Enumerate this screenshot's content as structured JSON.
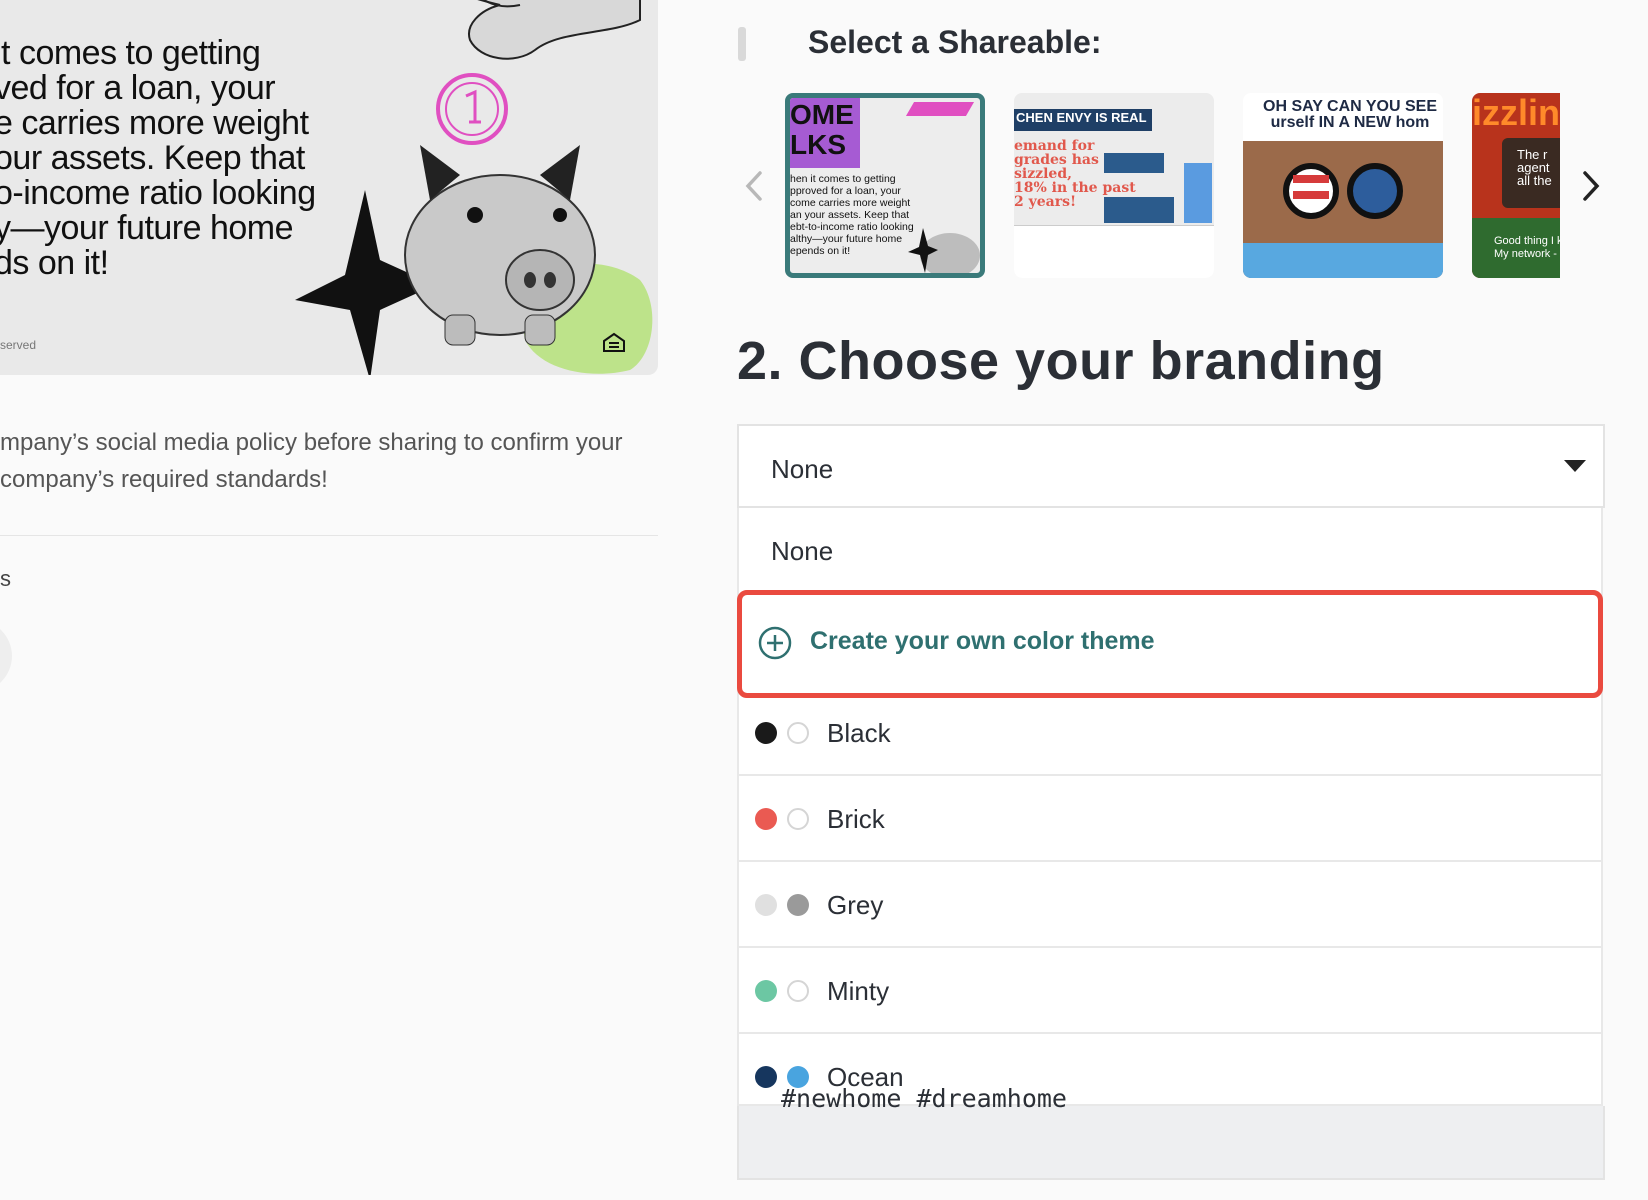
{
  "preview": {
    "text": "it comes to getting\nved for a loan, your\ne carries more weight\nour assets. Keep that\no-income ratio looking\ny—your future home\nds on it!",
    "footer": "served"
  },
  "policy_text": "mpany’s social media policy before sharing to confirm your company’s required standards!",
  "left_fragment": "s",
  "shareable": {
    "title": "Select a Shareable:",
    "thumbs": [
      {
        "heading": "OME\nLKS",
        "body": "hen it comes to getting\npproved for a loan, your\ncome carries more weight\nan your assets. Keep that\nebt-to-income ratio looking\nalthy—your future home\nepends on it!",
        "selected": true
      },
      {
        "heading": "CHEN ENVY IS REAL",
        "body": "emand for\ngrades has\nsizzled,\n18% in the past\n2 years!",
        "selected": false
      },
      {
        "heading": "OH SAY CAN YOU SEE\nurself IN A NEW hom",
        "body": "",
        "selected": false
      },
      {
        "heading": "izzlin",
        "body": "The r\nagent\nall the",
        "footer": "Good thing I kn\nMy network -",
        "selected": false
      }
    ]
  },
  "branding": {
    "title": "2. Choose your branding",
    "selected": "None",
    "options": {
      "none": "None",
      "create": "Create your own color theme",
      "themes": [
        {
          "label": "Black",
          "color1": "#1a1a1a",
          "color2": "#ffffff"
        },
        {
          "label": "Brick",
          "color1": "#ea5a52",
          "color2": "#ffffff"
        },
        {
          "label": "Grey",
          "color1": "#e0e0e0",
          "color2": "#9a9a9a"
        },
        {
          "label": "Minty",
          "color1": "#6cc7a3",
          "color2": "#ffffff"
        },
        {
          "label": "Ocean",
          "color1": "#16365e",
          "color2": "#49a4df"
        }
      ]
    }
  },
  "hashtags": "#newhome #dreamhome",
  "colors": {
    "accent": "#2f7070",
    "highlight": "#ea4a3f",
    "text": "#2b2f36"
  }
}
